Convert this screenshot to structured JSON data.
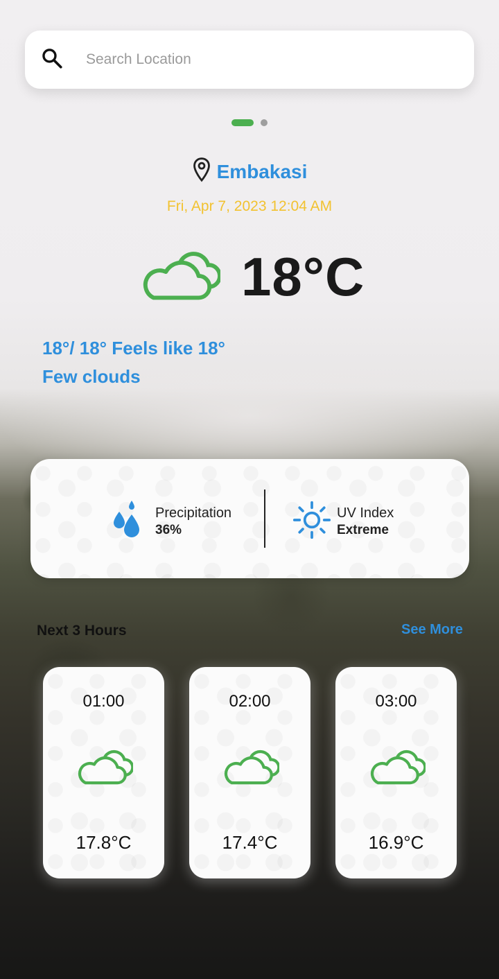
{
  "search": {
    "placeholder": "Search Location",
    "icon": "search-icon"
  },
  "pager": {
    "pages": 2,
    "active": 0,
    "active_color": "#4caf50"
  },
  "location": {
    "name": "Embakasi",
    "icon": "location-pin-icon"
  },
  "datetime": "Fri, Apr 7, 2023 12:04 AM",
  "current": {
    "icon": "cloud-icon",
    "temperature": "18°C",
    "feels_like": "18°/ 18° Feels like 18°",
    "description": "Few clouds"
  },
  "info": {
    "precipitation": {
      "label": "Precipitation",
      "value": "36%",
      "icon": "water-drops-icon"
    },
    "uv": {
      "label": "UV Index",
      "value": "Extreme",
      "icon": "sun-icon"
    }
  },
  "forecast": {
    "title": "Next 3 Hours",
    "see_more": "See More",
    "hours": [
      {
        "time": "01:00",
        "temp": "17.8°C",
        "icon": "cloud-icon"
      },
      {
        "time": "02:00",
        "temp": "17.4°C",
        "icon": "cloud-icon"
      },
      {
        "time": "03:00",
        "temp": "16.9°C",
        "icon": "cloud-icon"
      }
    ]
  },
  "colors": {
    "accent_blue": "#2f8fdc",
    "date_yellow": "#f2c230",
    "cloud_green": "#4caf50"
  }
}
